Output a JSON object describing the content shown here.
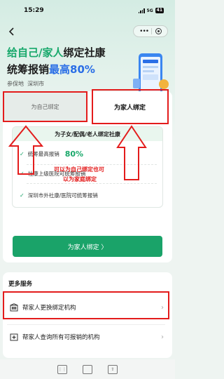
{
  "status": {
    "time": "15:29",
    "network": "5G",
    "battery": "41"
  },
  "hero": {
    "title_part1": "给自己/家人",
    "title_part2": "绑定社康",
    "title_part3": "统筹报销",
    "title_part4": "最高80%",
    "region_label": "参保地",
    "region_value": "深圳市"
  },
  "tabs": {
    "self": "为自己绑定",
    "family": "为家人绑定"
  },
  "benefits": {
    "heading": "为子女/配偶/老人绑定社康",
    "rows": [
      {
        "text": "统筹最高报销",
        "highlight": "80%"
      },
      {
        "text": "社康上级医院可统筹报销"
      },
      {
        "text": "深圳市外社康/医院可统筹报销"
      }
    ]
  },
  "cta": {
    "label": "为家人绑定 〉"
  },
  "more": {
    "title": "更多服务",
    "items": [
      {
        "label": "帮家人更换绑定机构"
      },
      {
        "label": "帮家人查询所有可报销的机构"
      }
    ]
  },
  "annotations": {
    "note1": "可以为自己绑定也可",
    "note2": "以为家庭绑定"
  },
  "colors": {
    "accent_green": "#1aa369",
    "accent_blue": "#2a6ee6",
    "annotation_red": "#e31c1c"
  }
}
